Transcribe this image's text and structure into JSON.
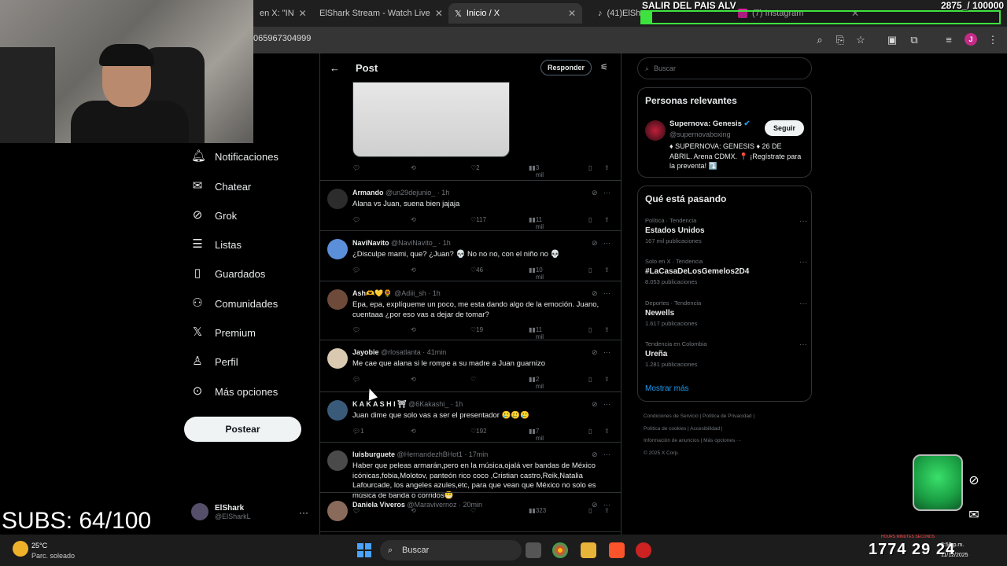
{
  "browser": {
    "tabs": [
      {
        "label": "en X: \"IN",
        "active": false
      },
      {
        "label": "ElShark Stream - Watch Live",
        "active": false
      },
      {
        "label": "Inicio / X",
        "active": true
      },
      {
        "label": "(41)ElShark Clips (@elshar",
        "active": false
      },
      {
        "label": "(7) Instagram",
        "active": false
      }
    ],
    "url": "065967304999"
  },
  "overlay": {
    "top_text": "SALIR DEL PAIS ALV",
    "goal": "2875_/ 100000",
    "goal_fraction": 0.02875,
    "subs": "SUBS: 64/100",
    "timer": "1774 29 24",
    "timer_labels": "HOURS MINUTES SECONDS"
  },
  "nav": {
    "items": [
      {
        "label": "Notificaciones",
        "icon": "bell-icon",
        "glyph": "🔔︎"
      },
      {
        "label": "Chatear",
        "icon": "mail-icon",
        "glyph": "✉"
      },
      {
        "label": "Grok",
        "icon": "grok-icon",
        "glyph": "⊘"
      },
      {
        "label": "Listas",
        "icon": "list-icon",
        "glyph": "☰"
      },
      {
        "label": "Guardados",
        "icon": "bookmark-icon",
        "glyph": "▯"
      },
      {
        "label": "Comunidades",
        "icon": "people-icon",
        "glyph": "⚇"
      },
      {
        "label": "Premium",
        "icon": "x-logo-icon",
        "glyph": "𝕏"
      },
      {
        "label": "Perfil",
        "icon": "person-icon",
        "glyph": "♙"
      },
      {
        "label": "Más opciones",
        "icon": "more-circle-icon",
        "glyph": "⊙"
      }
    ],
    "post_button": "Postear",
    "profile": {
      "name": "ElShark",
      "handle": "@ElSharkL"
    }
  },
  "post": {
    "title": "Post",
    "reply_button": "Responder",
    "main_actions": {
      "likes": "2",
      "views": "3 mil"
    }
  },
  "replies": [
    {
      "name": "Armando",
      "handle": "@un29dejunio_ · 1h",
      "text": "Alana vs Juan, suena bien jajaja",
      "replies": "",
      "likes": "117",
      "views": "11 mil",
      "avatar_color": "#2c2c2c"
    },
    {
      "name": "NaviNavito",
      "handle": "@NaviNavito_ · 1h",
      "text": "¿Disculpe mami, que? ¿Juan? 💀 No no no, con el niño no 💀",
      "replies": "",
      "likes": "46",
      "views": "10 mil",
      "avatar_color": "#5b8fd9"
    },
    {
      "name": "Ash🫶💛🌻",
      "handle": "@Adiii_sh · 1h",
      "text": "Epa, epa, explíqueme un poco, me esta dando algo de la emoción. Juano, cuentaaa ¿por eso vas a dejar de tomar?",
      "replies": "",
      "likes": "19",
      "views": "11 mil",
      "avatar_color": "#6e4a3a"
    },
    {
      "name": "Jayobie",
      "handle": "@rlosatlanta · 41min",
      "text": "Me cae que alana si le rompe a su madre a Juan guarnizo",
      "replies": "",
      "likes": "",
      "views": "2 mil",
      "avatar_color": "#d8c9b0"
    },
    {
      "name": "K A K A S H I ⛩",
      "handle": "@6Kakashi_ · 1h",
      "text": "Juan dime que solo vas a ser el presentador 🥲🥲🥲",
      "replies": "1",
      "likes": "192",
      "views": "7 mil",
      "avatar_color": "#3a5a7a"
    },
    {
      "name": "luisburguete",
      "handle": "@HernandezhBHot1 · 17min",
      "text": "Haber que peleas armarán,pero en la música,ojalá ver bandas de México icónicas,fobia,Molotov, panteón rico coco ,Cristian castro,Reik,Natalia Lafourcade, los angeles azules,etc, para que vean que México no solo es música de banda o corridos😁",
      "replies": "",
      "likes": "",
      "views": "323",
      "avatar_color": "#4a4a4a"
    },
    {
      "name": "Daniela Viveros",
      "handle": "@Maravivernoz · 20min",
      "text": "",
      "replies": "",
      "likes": "",
      "views": "",
      "avatar_color": "#8a6a5a"
    }
  ],
  "right": {
    "search_placeholder": "Buscar",
    "relevant_title": "Personas relevantes",
    "person": {
      "name": "Supernova: Genesis",
      "handle": "@supernovaboxing",
      "bio": "♦ SUPERNOVA: GENESIS ♦ 26 DE ABRIL. Arena CDMX. 📍 ¡Regístrate para la preventa! ⤵️",
      "follow": "Seguir"
    },
    "trends_title": "Qué está pasando",
    "trends": [
      {
        "context": "Política · Tendencia",
        "name": "Estados Unidos",
        "count": "167 mil publicaciones"
      },
      {
        "context": "Solo en X · Tendencia",
        "name": "#LaCasaDeLosGemelos2D4",
        "count": "8.053 publicaciones"
      },
      {
        "context": "Deportes · Tendencia",
        "name": "Newells",
        "count": "1.617 publicaciones"
      },
      {
        "context": "Tendencia en Colombia",
        "name": "Ureña",
        "count": "1.281 publicaciones"
      }
    ],
    "show_more": "Mostrar más",
    "footer": [
      "Condiciones de Servicio",
      "Política de Privacidad",
      "Política de cookies",
      "Accesibilidad",
      "Información de anuncios",
      "Más opciones ···",
      "© 2025 X Corp."
    ]
  },
  "taskbar": {
    "temp": "25°C",
    "weather": "Parc. soleado",
    "search": "Buscar",
    "time": "3:59 p.m.",
    "date": "11/12/2025"
  },
  "colors": {
    "accent": "#1d9bf0",
    "goal_green": "#3ee23e"
  }
}
